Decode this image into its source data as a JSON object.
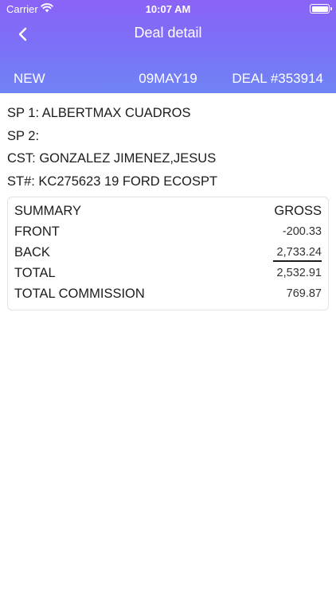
{
  "status_bar": {
    "carrier": "Carrier",
    "time": "10:07 AM"
  },
  "nav": {
    "title": "Deal detail",
    "back_icon": "chevron-left-icon"
  },
  "info": {
    "status": "NEW",
    "date": "09MAY19",
    "deal": "DEAL #353914"
  },
  "details": {
    "sp1": "SP 1: ALBERTMAX CUADROS",
    "sp2": "SP 2:",
    "cst": "CST: GONZALEZ JIMENEZ,JESUS",
    "st": "ST#: KC275623 19 FORD ECOSPT"
  },
  "summary": {
    "header_label": "SUMMARY",
    "header_value": "GROSS",
    "rows": [
      {
        "label": "FRONT",
        "value": "-200.33"
      },
      {
        "label": "BACK",
        "value": "2,733.24"
      },
      {
        "label": "TOTAL",
        "value": "2,532.91"
      },
      {
        "label": "TOTAL COMMISSION",
        "value": "769.87"
      }
    ]
  },
  "colors": {
    "header_top": "#8a63f7",
    "header_bottom": "#6f84f4"
  }
}
